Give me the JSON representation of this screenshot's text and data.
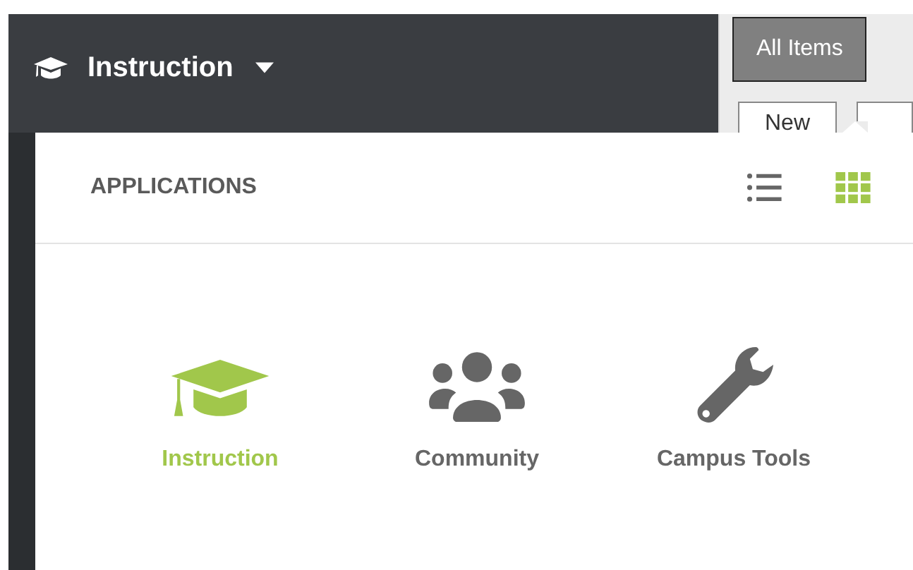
{
  "header": {
    "title": "Instruction"
  },
  "toolbar": {
    "tabs": [
      {
        "label": "All Items",
        "selected": true
      }
    ],
    "buttons": [
      "New"
    ]
  },
  "applications_menu": {
    "title": "APPLICATIONS",
    "view_modes": [
      {
        "kind": "list",
        "selected": false
      },
      {
        "kind": "grid",
        "selected": true
      }
    ],
    "apps": [
      {
        "kind": "cap",
        "label": "Instruction",
        "selected": true
      },
      {
        "kind": "people",
        "label": "Community",
        "selected": false
      },
      {
        "kind": "wrench",
        "label": "Campus Tools",
        "selected": false
      }
    ]
  }
}
